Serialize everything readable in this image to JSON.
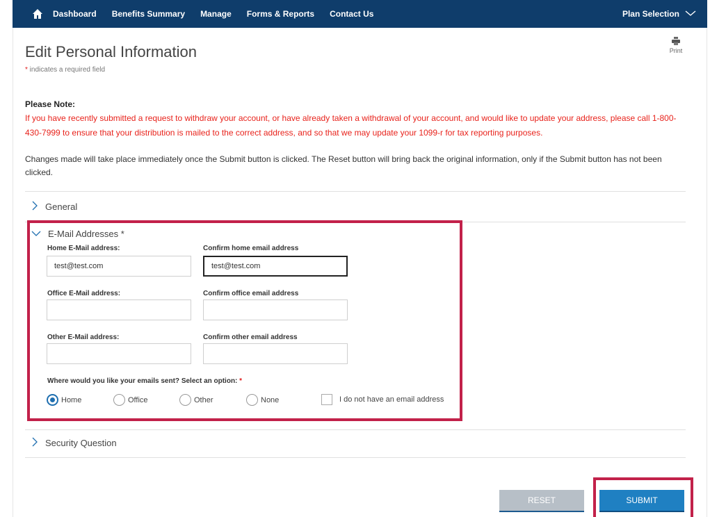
{
  "nav": {
    "items": [
      "Dashboard",
      "Benefits Summary",
      "Manage",
      "Forms & Reports",
      "Contact Us"
    ],
    "plan_selection": "Plan Selection"
  },
  "page": {
    "title": "Edit Personal Information",
    "required_star": "*",
    "required_note": " indicates a required field",
    "print_label": "Print"
  },
  "notice": {
    "heading": "Please Note:",
    "red_text": "If you have recently submitted a request to withdraw your account, or have already taken a withdrawal of your account, and would like to update your address, please call 1-800-430-7999 to ensure that your distribution is mailed to the correct address, and so that we may update your 1099-r for tax reporting purposes.",
    "changes_text": "Changes made will take place immediately once the Submit button is clicked. The Reset button will bring back the original information, only if the Submit button has not been clicked."
  },
  "sections": {
    "general": "General",
    "email": "E-Mail Addresses *",
    "security": "Security Question"
  },
  "email_form": {
    "home_label": "Home E-Mail address:",
    "home_value": "test@test.com",
    "confirm_home_label": "Confirm home email address",
    "confirm_home_value": "test@test.com",
    "office_label": "Office E-Mail address:",
    "office_value": "",
    "confirm_office_label": "Confirm office email address",
    "confirm_office_value": "",
    "other_label": "Other E-Mail address:",
    "other_value": "",
    "confirm_other_label": "Confirm other email address",
    "confirm_other_value": "",
    "question": "Where would you like your emails sent? Select an option:",
    "question_star": "*",
    "options": [
      "Home",
      "Office",
      "Other",
      "None"
    ],
    "selected_option": "Home",
    "no_email_label": "I do not have an email address",
    "no_email_checked": false
  },
  "buttons": {
    "reset": "RESET",
    "submit": "SUBMIT"
  },
  "colors": {
    "nav_bg": "#0f3d6b",
    "notice_red": "#e8221b",
    "highlight_box": "#c2214a",
    "submit_blue": "#1f80c2",
    "reset_gray": "#b7bfc7"
  }
}
